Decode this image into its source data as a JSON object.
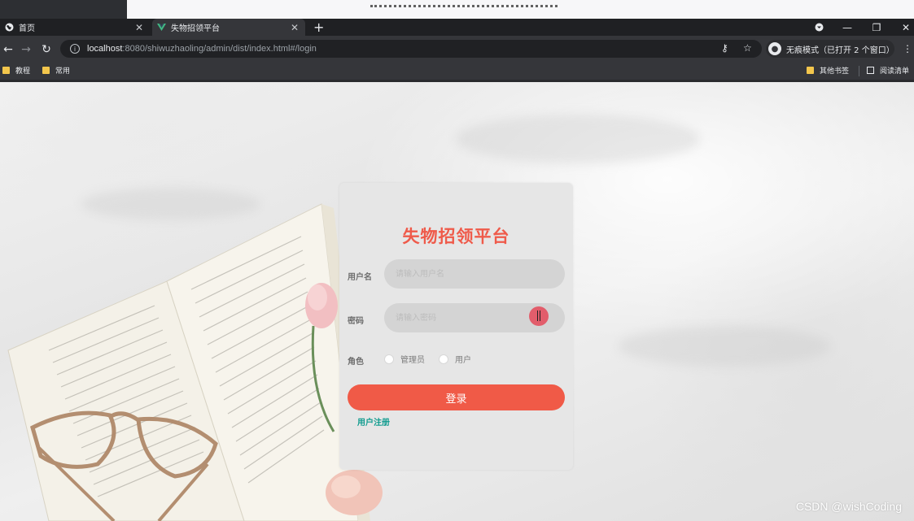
{
  "browser": {
    "tabs": [
      {
        "label": "首页",
        "icon": "globe-icon"
      },
      {
        "label": "失物招领平台",
        "icon": "vue-icon",
        "active": true
      }
    ],
    "new_tab_symbol": "+",
    "address": {
      "host": "localhost",
      "path": ":8080/shiwuzhaoling/admin/dist/index.html#/login"
    },
    "incognito_label": "无痕模式（已打开 2 个窗口）",
    "bookmarks": [
      "教程",
      "常用"
    ],
    "bookmarks_right": [
      "其他书签",
      "阅读清单"
    ]
  },
  "login": {
    "title": "失物招领平台",
    "username_label": "用户名",
    "username_placeholder": "请输入用户名",
    "password_label": "密码",
    "password_placeholder": "请输入密码",
    "role_label": "角色",
    "roles": [
      "管理员",
      "用户"
    ],
    "login_button": "登录",
    "register_link": "用户注册"
  },
  "watermark": "CSDN @wishCoding",
  "colors": {
    "title": "#ef5a4a",
    "button": "#f05a47",
    "link": "#0f9b8e",
    "card": "#e6e6e6"
  }
}
